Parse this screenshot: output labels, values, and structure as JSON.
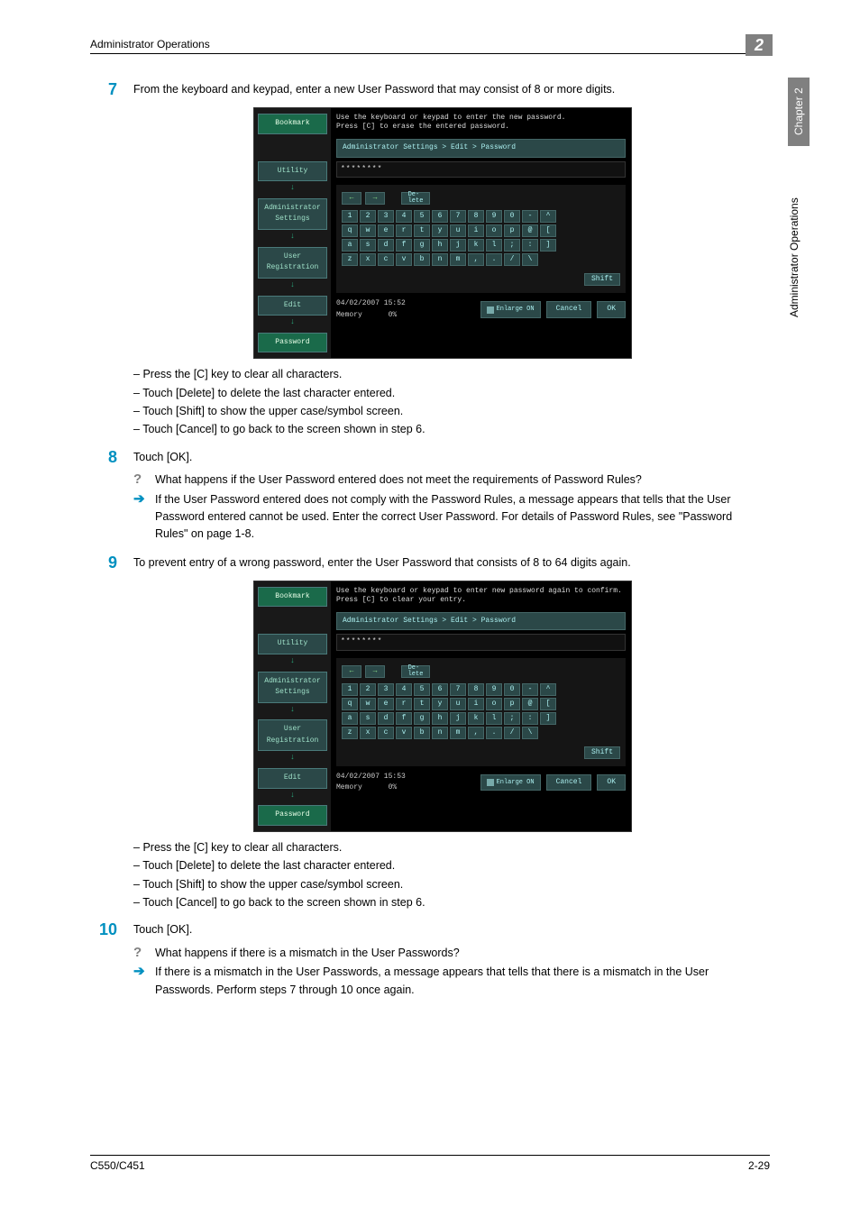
{
  "header": {
    "title": "Administrator Operations",
    "chapter_number": "2"
  },
  "sidetab": {
    "chapter_label": "Chapter 2",
    "section_label": "Administrator Operations"
  },
  "footer": {
    "model": "C550/C451",
    "page": "2-29"
  },
  "steps": {
    "s7": {
      "num": "7",
      "text": "From the keyboard and keypad, enter a new User Password that may consist of 8 or more digits.",
      "bullets": [
        "Press the [C] key to clear all characters.",
        "Touch [Delete] to delete the last character entered.",
        "Touch [Shift] to show the upper case/symbol screen.",
        "Touch [Cancel] to go back to the screen shown in step 6."
      ]
    },
    "s8": {
      "num": "8",
      "text": "Touch [OK].",
      "q": "What happens if the User Password entered does not meet the requirements of Password Rules?",
      "a": "If the User Password entered does not comply with the Password Rules, a message appears that tells that the User Password entered cannot be used. Enter the correct User Password. For details of Password Rules, see \"Password Rules\" on page 1-8."
    },
    "s9": {
      "num": "9",
      "text": "To prevent entry of a wrong password, enter the User Password that consists of 8 to 64 digits again.",
      "bullets": [
        "Press the [C] key to clear all characters.",
        "Touch [Delete] to delete the last character entered.",
        "Touch [Shift] to show the upper case/symbol screen.",
        "Touch [Cancel] to go back to the screen shown in step 6."
      ]
    },
    "s10": {
      "num": "10",
      "text": "Touch [OK].",
      "q": "What happens if there is a mismatch in the User Passwords?",
      "a": "If there is a mismatch in the User Passwords, a message appears that tells that there is a mismatch in the User Passwords. Perform steps 7 through 10 once again."
    }
  },
  "panel_common": {
    "breadcrumb": "Administrator Settings > Edit > Password",
    "input_mask": "********",
    "left_buttons": {
      "bookmark": "Bookmark",
      "utility": "Utility",
      "admin": "Administrator Settings",
      "userreg": "User Registration",
      "edit": "Edit",
      "password": "Password"
    },
    "keys": {
      "delete": "De-\nlete",
      "shift": "Shift",
      "row1": [
        "1",
        "2",
        "3",
        "4",
        "5",
        "6",
        "7",
        "8",
        "9",
        "0",
        "-",
        "^"
      ],
      "row2": [
        "q",
        "w",
        "e",
        "r",
        "t",
        "y",
        "u",
        "i",
        "o",
        "p",
        "@",
        "["
      ],
      "row3": [
        "a",
        "s",
        "d",
        "f",
        "g",
        "h",
        "j",
        "k",
        "l",
        ";",
        ":",
        "]"
      ],
      "row4": [
        "z",
        "x",
        "c",
        "v",
        "b",
        "n",
        "m",
        ",",
        ".",
        "/",
        "\\"
      ]
    },
    "footer_buttons": {
      "enlarge": "Enlarge ON",
      "cancel": "Cancel",
      "ok": "OK"
    },
    "memory_label": "Memory",
    "memory_value": "0%"
  },
  "panel1": {
    "instruction": "Use the keyboard or keypad to enter the new password.\nPress [C] to erase the entered password.",
    "datetime": "04/02/2007   15:52"
  },
  "panel2": {
    "instruction": "Use the keyboard or keypad to enter new password again to confirm.\nPress [C] to clear your entry.",
    "datetime": "04/02/2007   15:53"
  }
}
